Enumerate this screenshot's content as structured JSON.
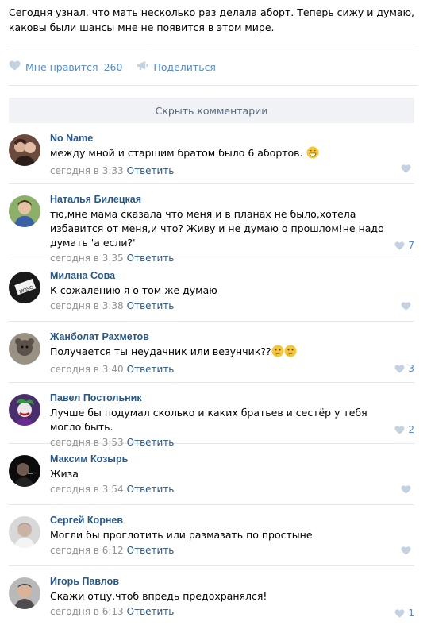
{
  "post": {
    "text": "Сегодня узнал, что мать несколько раз делала аборт. Теперь сижу и думаю, каковы были шансы мне не появится в этом мире.",
    "like_label": "Мне нравится",
    "like_count": "260",
    "share_label": "Поделиться",
    "icons": {
      "like": "heart-icon",
      "share": "megaphone-icon"
    }
  },
  "hide_comments_label": "Скрыть комментарии",
  "reply_label": "Ответить",
  "colors": {
    "link": "#2a5885",
    "accent": "#528bcc",
    "muted": "#939393",
    "divider": "#e7e8ec",
    "button_bg": "#f0f2f5"
  },
  "comments": [
    {
      "author": "No Name",
      "text": "между мной и старшим братом было 6 абортов.",
      "emoji": "grinning-face",
      "time": "сегодня в 3:33",
      "likes": ""
    },
    {
      "author": "Наталья Билецкая",
      "text": "тю,мне мама сказала что меня и в планах не было,хотела избавится от меня,и что? Живу и не думаю о прошлом!не надо думать 'а если?'",
      "time": "сегодня в 3:35",
      "likes": "7"
    },
    {
      "author": "Милана Сова",
      "text": "К сожалению я о том же думаю",
      "time": "сегодня в 3:38",
      "likes": ""
    },
    {
      "author": "Жанболат Рахметов",
      "text": "Получается ты неудачник или везунчик??",
      "emoji": "thinking-face-x2",
      "time": "сегодня в 3:40",
      "likes": "3"
    },
    {
      "author": "Павел Постольник",
      "text": "Лучше бы подумал сколько и каких братьев и сестёр у тебя могло быть.",
      "time": "сегодня в 3:53",
      "likes": "2"
    },
    {
      "author": "Максим Козырь",
      "text": "Жиза",
      "time": "сегодня в 3:54",
      "likes": ""
    },
    {
      "author": "Сергей Корнев",
      "text": "Могли бы проглотить или размазать по простыне",
      "time": "сегодня в 6:12",
      "likes": ""
    },
    {
      "author": "Игорь Павлов",
      "text": "Скажи отцу,чтоб впредь предохранялся!",
      "time": "сегодня в 6:13",
      "likes": "1"
    }
  ]
}
